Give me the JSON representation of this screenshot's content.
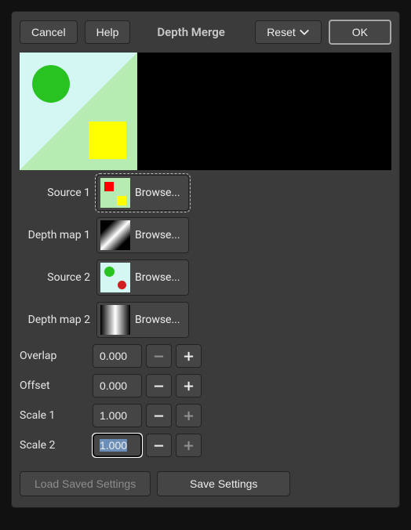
{
  "topbar": {
    "cancel": "Cancel",
    "help": "Help",
    "title": "Depth Merge",
    "reset": "Reset",
    "ok": "OK"
  },
  "fields": {
    "source1": {
      "label": "Source 1",
      "button": "Browse..."
    },
    "depthmap1": {
      "label": "Depth map 1",
      "button": "Browse..."
    },
    "source2": {
      "label": "Source 2",
      "button": "Browse..."
    },
    "depthmap2": {
      "label": "Depth map 2",
      "button": "Browse..."
    },
    "overlap": {
      "label": "Overlap",
      "value": "0.000"
    },
    "offset": {
      "label": "Offset",
      "value": "0.000"
    },
    "scale1": {
      "label": "Scale 1",
      "value": "1.000"
    },
    "scale2": {
      "label": "Scale 2",
      "value": "1.000"
    }
  },
  "bottom": {
    "load": "Load Saved Settings",
    "save": "Save Settings"
  }
}
